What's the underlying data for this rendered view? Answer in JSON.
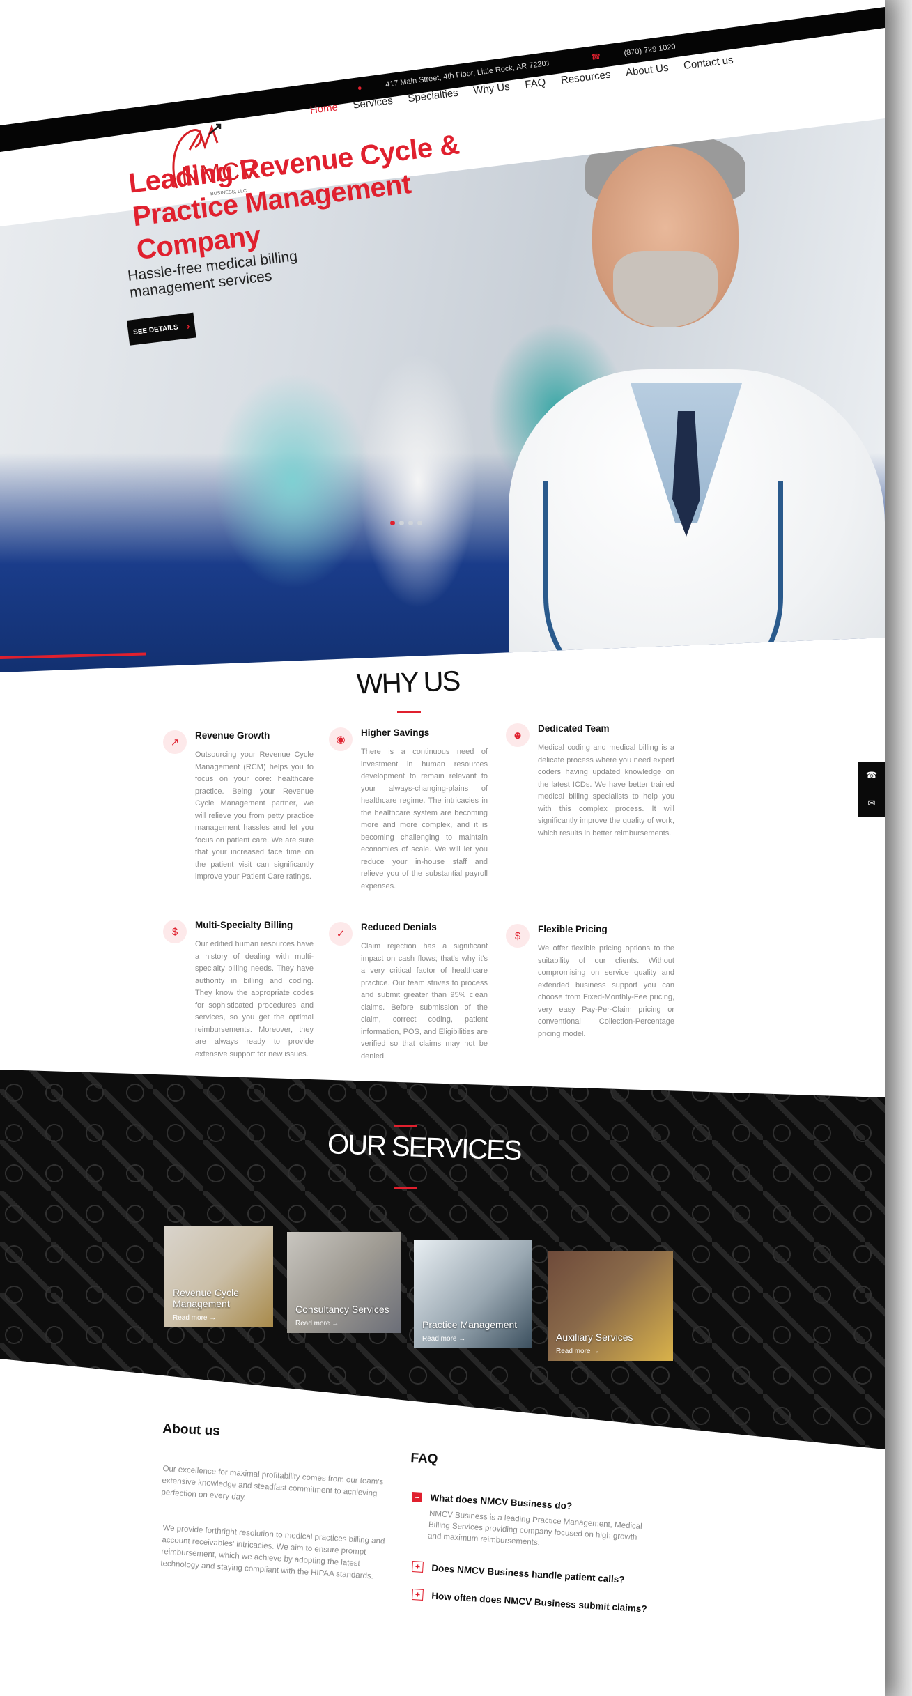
{
  "topbar": {
    "address": "417 Main Street, 4th Floor, Little Rock, AR 72201",
    "phone": "(870) 729 1020",
    "address_icon": "map-pin-icon",
    "phone_icon": "phone-icon"
  },
  "logo": {
    "name": "NMCV",
    "tagline": "BUSINESS, LLC"
  },
  "nav": {
    "items": [
      {
        "label": "Home",
        "active": true
      },
      {
        "label": "Services",
        "active": false
      },
      {
        "label": "Specialties",
        "active": false
      },
      {
        "label": "Why Us",
        "active": false
      },
      {
        "label": "FAQ",
        "active": false
      },
      {
        "label": "Resources",
        "active": false
      },
      {
        "label": "About Us",
        "active": false
      },
      {
        "label": "Contact us",
        "active": false
      }
    ]
  },
  "hero": {
    "title": "Leading Revenue Cycle & Practice Management Company",
    "subtitle": "Hassle-free medical billing management services",
    "button_label": "SEE DETAILS",
    "slide_count": 4,
    "active_slide": 1
  },
  "why_us": {
    "title": "WHY US",
    "features": [
      {
        "icon": "chart-growth-icon",
        "title": "Revenue Growth",
        "text": "Outsourcing your Revenue Cycle Management (RCM) helps you to focus on your core: healthcare practice. Being your Revenue Cycle Management partner, we will relieve you from petty practice management hassles and let you focus on patient care. We are sure that your increased face time on the patient visit can significantly improve your Patient Care ratings."
      },
      {
        "icon": "piggy-bank-icon",
        "title": "Higher Savings",
        "text": "There is a continuous need of investment in human resources development to remain relevant to your always-changing-plains of healthcare regime. The intricacies in the healthcare system are becoming more and more complex, and it is becoming challenging to maintain economies of scale. We will let you reduce your in-house staff and relieve you of the substantial payroll expenses."
      },
      {
        "icon": "team-icon",
        "title": "Dedicated Team",
        "text": "Medical coding and medical billing is a delicate process where you need expert coders having updated knowledge on the latest ICDs. We have better trained medical billing specialists to help you with this complex process. It will significantly improve the quality of work, which results in better reimbursements."
      },
      {
        "icon": "billing-document-icon",
        "title": "Multi-Specialty Billing",
        "text": "Our edified human resources have a history of dealing with multi-specialty billing needs. They have authority in billing and coding. They know the appropriate codes for sophisticated procedures and services, so you get the optimal reimbursements. Moreover, they are always ready to provide extensive support for new issues."
      },
      {
        "icon": "clipboard-check-icon",
        "title": "Reduced Denials",
        "text": "Claim rejection has a significant impact on cash flows; that's why it's a very critical factor of healthcare practice. Our team strives to process and submit greater than 95% clean claims. Before submission of the claim, correct coding, patient information, POS, and Eligibilities are verified so that claims may not be denied."
      },
      {
        "icon": "hand-dollar-icon",
        "title": "Flexible Pricing",
        "text": "We offer flexible pricing options to the suitability of our clients. Without compromising on service quality and extended business support you can choose from Fixed-Monthly-Fee pricing, very easy Pay-Per-Claim pricing or conventional Collection-Percentage pricing model."
      }
    ]
  },
  "floating_contact": {
    "phone_icon": "phone-icon",
    "mail_icon": "envelope-icon"
  },
  "services": {
    "title": "OUR SERVICES",
    "read_more": "Read more",
    "cards": [
      {
        "label": "Revenue Cycle Management",
        "color_a": "#d9d4cc",
        "color_b": "#a88a4a"
      },
      {
        "label": "Consultancy Services",
        "color_a": "#c9c6c0",
        "color_b": "#6b6e78"
      },
      {
        "label": "Practice Management",
        "color_a": "#e8eef2",
        "color_b": "#3b7fa7"
      },
      {
        "label": "Auxiliary Services",
        "color_a": "#6e4a3a",
        "color_b": "#d9b24a"
      }
    ]
  },
  "about": {
    "title": "About us",
    "paragraph_1": "Our excellence for maximal profitability comes from our team's extensive knowledge and steadfast commitment to achieving perfection on every day.",
    "paragraph_2": "We provide forthright resolution to medical practices billing and account receivables' intricacies. We aim to ensure prompt reimbursement, which we achieve by adopting the latest technology and staying compliant with the HIPAA standards."
  },
  "faq": {
    "title": "FAQ",
    "items": [
      {
        "question": "What does NMCV Business do?",
        "answer": "NMCV Business is a leading Practice Management, Medical Billing Services providing company focused on high growth and maximum reimbursements.",
        "open": true
      },
      {
        "question": "Does NMCV Business handle patient calls?",
        "answer": "",
        "open": false
      },
      {
        "question": "How often does NMCV Business submit claims?",
        "answer": "",
        "open": false
      }
    ]
  },
  "colors": {
    "accent": "#e0202e",
    "dark": "#0d0d0d",
    "text_muted": "#8a8a8a"
  }
}
